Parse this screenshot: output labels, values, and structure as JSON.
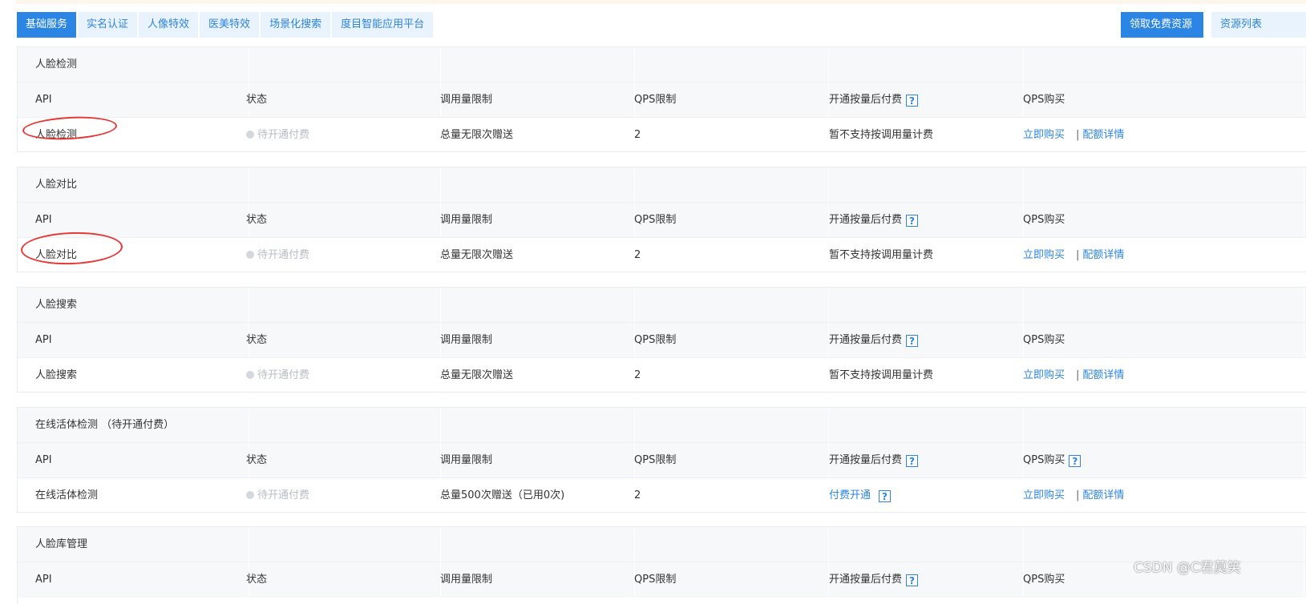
{
  "tabs": [
    {
      "label": "基础服务",
      "active": true
    },
    {
      "label": "实名认证",
      "active": false
    },
    {
      "label": "人像特效",
      "active": false
    },
    {
      "label": "医美特效",
      "active": false
    },
    {
      "label": "场景化搜索",
      "active": false
    },
    {
      "label": "度目智能应用平台",
      "active": false
    }
  ],
  "actions": {
    "free_resource": "领取免费资源",
    "resource_list": "资源列表"
  },
  "columns": {
    "api": "API",
    "status": "状态",
    "quota": "调用量限制",
    "qps": "QPS限制",
    "postpaid": "开通按量后付费",
    "qps_buy": "QPS购买"
  },
  "help_icon": "?",
  "sections": [
    {
      "title": "人脸检测",
      "api": "人脸检测",
      "status": "待开通付费",
      "quota": "总量无限次赠送",
      "qps": "2",
      "postpaid": "暂不支持按调用量计费",
      "buy": "立即购买",
      "separator": "|",
      "details": "配额详情"
    },
    {
      "title": "人脸对比",
      "api": "人脸对比",
      "status": "待开通付费",
      "quota": "总量无限次赠送",
      "qps": "2",
      "postpaid": "暂不支持按调用量计费",
      "buy": "立即购买",
      "separator": "|",
      "details": "配额详情"
    },
    {
      "title": "人脸搜索",
      "api": "人脸搜索",
      "status": "待开通付费",
      "quota": "总量无限次赠送",
      "qps": "2",
      "postpaid": "暂不支持按调用量计费",
      "buy": "立即购买",
      "separator": "|",
      "details": "配额详情"
    },
    {
      "title": "在线活体检测 （待开通付费）",
      "api": "在线活体检测",
      "status": "待开通付费",
      "quota": "总量500次赠送（已用0次)",
      "qps": "2",
      "postpaid": "付费开通",
      "buy": "立即购买",
      "separator": "|",
      "details": "配额详情"
    },
    {
      "title": "人脸库管理"
    }
  ],
  "watermark": "CSDN @C君莫笑",
  "colors": {
    "accent": "#2b85e4",
    "annotation": "#e53935"
  }
}
